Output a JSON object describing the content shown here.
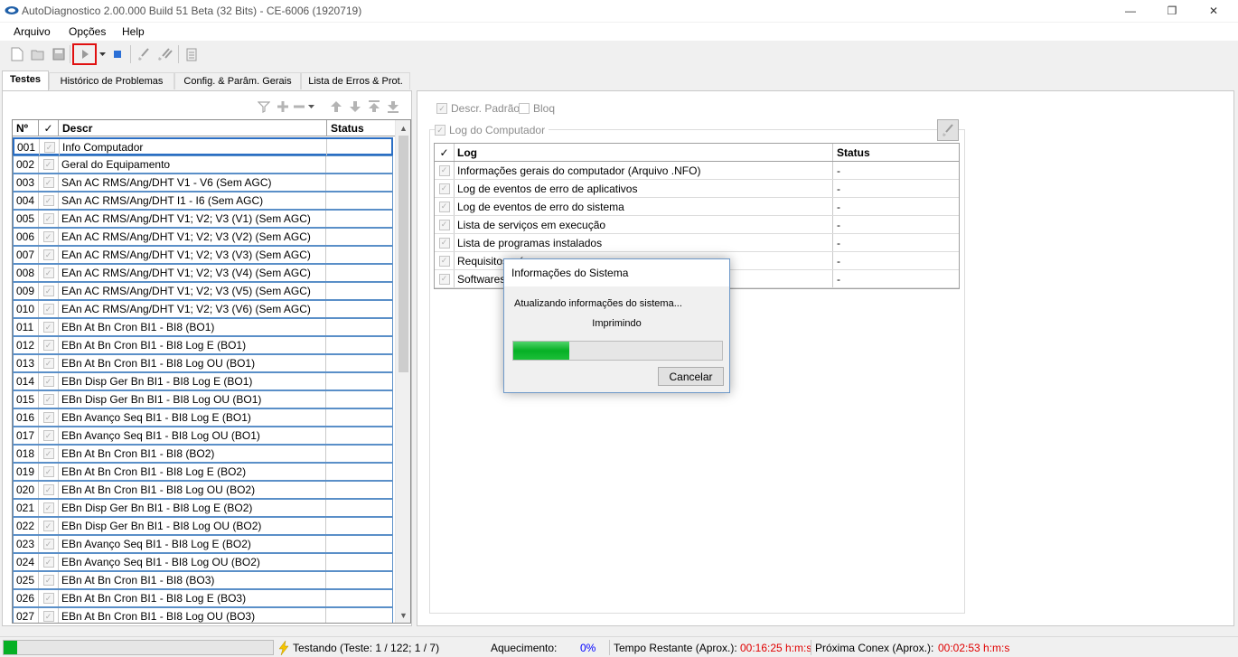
{
  "window": {
    "title": "AutoDiagnostico 2.00.000 Build 51 Beta (32 Bits) - CE-6006 (1920719)",
    "minimize": "—",
    "maximize": "❐",
    "close": "✕"
  },
  "menu": [
    "Arquivo",
    "Opções",
    "Help"
  ],
  "tabs": [
    "Testes",
    "Histórico de Problemas",
    "Config. & Parâm. Gerais",
    "Lista de Erros & Prot."
  ],
  "tests_grid": {
    "headers": {
      "num": "Nº",
      "check": "✓",
      "descr": "Descr",
      "status": "Status"
    },
    "rows": [
      {
        "num": "001",
        "descr": "Info Computador",
        "status": ""
      },
      {
        "num": "002",
        "descr": "Geral do Equipamento",
        "status": ""
      },
      {
        "num": "003",
        "descr": "SAn AC RMS/Ang/DHT V1 - V6 (Sem AGC)",
        "status": ""
      },
      {
        "num": "004",
        "descr": "SAn AC RMS/Ang/DHT I1 - I6 (Sem AGC)",
        "status": ""
      },
      {
        "num": "005",
        "descr": "EAn AC RMS/Ang/DHT V1; V2; V3 (V1) (Sem AGC)",
        "status": ""
      },
      {
        "num": "006",
        "descr": "EAn AC RMS/Ang/DHT V1; V2; V3 (V2) (Sem AGC)",
        "status": ""
      },
      {
        "num": "007",
        "descr": "EAn AC RMS/Ang/DHT V1; V2; V3 (V3) (Sem AGC)",
        "status": ""
      },
      {
        "num": "008",
        "descr": "EAn AC RMS/Ang/DHT V1; V2; V3 (V4) (Sem AGC)",
        "status": ""
      },
      {
        "num": "009",
        "descr": "EAn AC RMS/Ang/DHT V1; V2; V3 (V5) (Sem AGC)",
        "status": ""
      },
      {
        "num": "010",
        "descr": "EAn AC RMS/Ang/DHT V1; V2; V3 (V6) (Sem AGC)",
        "status": ""
      },
      {
        "num": "011",
        "descr": "EBn At Bn Cron BI1 - BI8 (BO1)",
        "status": ""
      },
      {
        "num": "012",
        "descr": "EBn At Bn Cron BI1 - BI8 Log E (BO1)",
        "status": ""
      },
      {
        "num": "013",
        "descr": "EBn At Bn Cron BI1 - BI8 Log OU (BO1)",
        "status": ""
      },
      {
        "num": "014",
        "descr": "EBn Disp Ger Bn BI1 - BI8 Log E (BO1)",
        "status": ""
      },
      {
        "num": "015",
        "descr": "EBn Disp Ger Bn BI1 - BI8 Log OU (BO1)",
        "status": ""
      },
      {
        "num": "016",
        "descr": "EBn Avanço Seq BI1 - BI8 Log E (BO1)",
        "status": ""
      },
      {
        "num": "017",
        "descr": "EBn Avanço Seq BI1 - BI8 Log OU (BO1)",
        "status": ""
      },
      {
        "num": "018",
        "descr": "EBn At Bn Cron BI1 - BI8 (BO2)",
        "status": ""
      },
      {
        "num": "019",
        "descr": "EBn At Bn Cron BI1 - BI8 Log E (BO2)",
        "status": ""
      },
      {
        "num": "020",
        "descr": "EBn At Bn Cron BI1 - BI8 Log OU (BO2)",
        "status": ""
      },
      {
        "num": "021",
        "descr": "EBn Disp Ger Bn BI1 - BI8 Log E (BO2)",
        "status": ""
      },
      {
        "num": "022",
        "descr": "EBn Disp Ger Bn BI1 - BI8 Log OU (BO2)",
        "status": ""
      },
      {
        "num": "023",
        "descr": "EBn Avanço Seq BI1 - BI8 Log E (BO2)",
        "status": ""
      },
      {
        "num": "024",
        "descr": "EBn Avanço Seq BI1 - BI8 Log OU (BO2)",
        "status": ""
      },
      {
        "num": "025",
        "descr": "EBn At Bn Cron BI1 - BI8 (BO3)",
        "status": ""
      },
      {
        "num": "026",
        "descr": "EBn At Bn Cron BI1 - BI8 Log E (BO3)",
        "status": ""
      },
      {
        "num": "027",
        "descr": "EBn At Bn Cron BI1 - BI8 Log OU (BO3)",
        "status": ""
      }
    ]
  },
  "right_panel": {
    "descr_padrao": "Descr. Padrão",
    "bloq": "Bloq",
    "log_computador": "Log do Computador",
    "log_grid": {
      "headers": {
        "check": "✓",
        "log": "Log",
        "status": "Status"
      },
      "rows": [
        {
          "log": "Informações gerais do computador (Arquivo .NFO)",
          "status": "-"
        },
        {
          "log": "Log de eventos de erro de aplicativos",
          "status": "-"
        },
        {
          "log": "Log de eventos de erro do sistema",
          "status": "-"
        },
        {
          "log": "Lista de serviços em execução",
          "status": "-"
        },
        {
          "log": "Lista de programas instalados",
          "status": "-"
        },
        {
          "log": "Requisitos mí",
          "status": "-"
        },
        {
          "log": "Softwares",
          "status": "-"
        }
      ]
    }
  },
  "dialog": {
    "title": "Informações do Sistema",
    "message": "Atualizando informações do sistema...",
    "sub": "Imprimindo",
    "progress": 0.27,
    "cancel": "Cancelar"
  },
  "statusbar": {
    "progress": 0.05,
    "testing": "Testando (Teste: 1 / 122; 1 / 7)",
    "aquecimento_label": "Aquecimento:",
    "aquecimento_value": "0%",
    "tempo_label": "Tempo Restante (Aprox.):",
    "tempo_value": "00:16:25 h:m:s",
    "proxima_label": "Próxima Conex (Aprox.):",
    "proxima_value": "00:02:53 h:m:s"
  },
  "colors": {
    "progress_green": "#06b025",
    "value_blue": "#0000ff",
    "value_red": "#e00000",
    "highlight_red": "#e01010"
  }
}
